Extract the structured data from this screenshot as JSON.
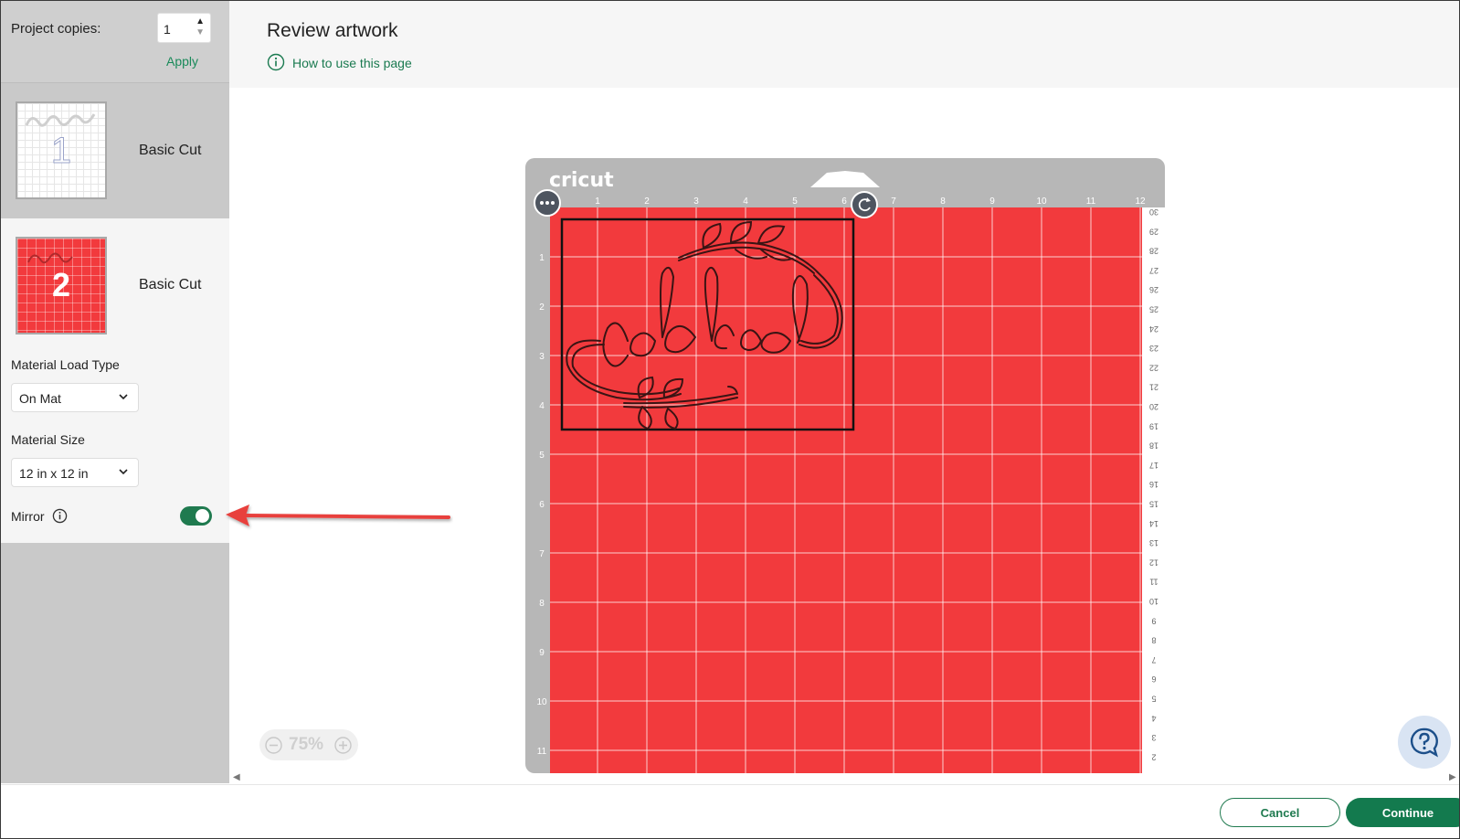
{
  "sidebar": {
    "copies_label": "Project copies:",
    "copies_value": "1",
    "apply_label": "Apply",
    "mats": [
      {
        "number": "1",
        "label": "Basic Cut"
      },
      {
        "number": "2",
        "label": "Basic Cut"
      }
    ],
    "material_load_type_label": "Material Load Type",
    "material_load_type_value": "On Mat",
    "material_size_label": "Material Size",
    "material_size_value": "12 in x 12 in",
    "mirror_label": "Mirror",
    "mirror_on": true
  },
  "header": {
    "title": "Review artwork",
    "how_to_link": "How to use this page"
  },
  "mat_preview": {
    "brand": "cricut",
    "mat_color": "#f23a3d",
    "top_ruler": [
      "1",
      "2",
      "3",
      "4",
      "5",
      "6",
      "7",
      "8",
      "9",
      "10",
      "11",
      "12"
    ],
    "left_ruler": [
      "1",
      "2",
      "3",
      "4",
      "5",
      "6",
      "7",
      "8",
      "9",
      "10",
      "11"
    ],
    "right_ruler": [
      "30",
      "29",
      "28",
      "27",
      "26",
      "25",
      "24",
      "23",
      "22",
      "21",
      "20",
      "19",
      "18",
      "17",
      "16",
      "15",
      "14",
      "13",
      "12",
      "11",
      "10",
      "9",
      "8",
      "7",
      "6",
      "5",
      "4",
      "3",
      "2"
    ]
  },
  "canvas": {
    "zoom_level": "75%"
  },
  "footer": {
    "cancel_label": "Cancel",
    "continue_label": "Continue"
  },
  "colors": {
    "accent": "#1f7a4f",
    "mat_red": "#f23a3d",
    "annotation_arrow": "#e8403e"
  }
}
